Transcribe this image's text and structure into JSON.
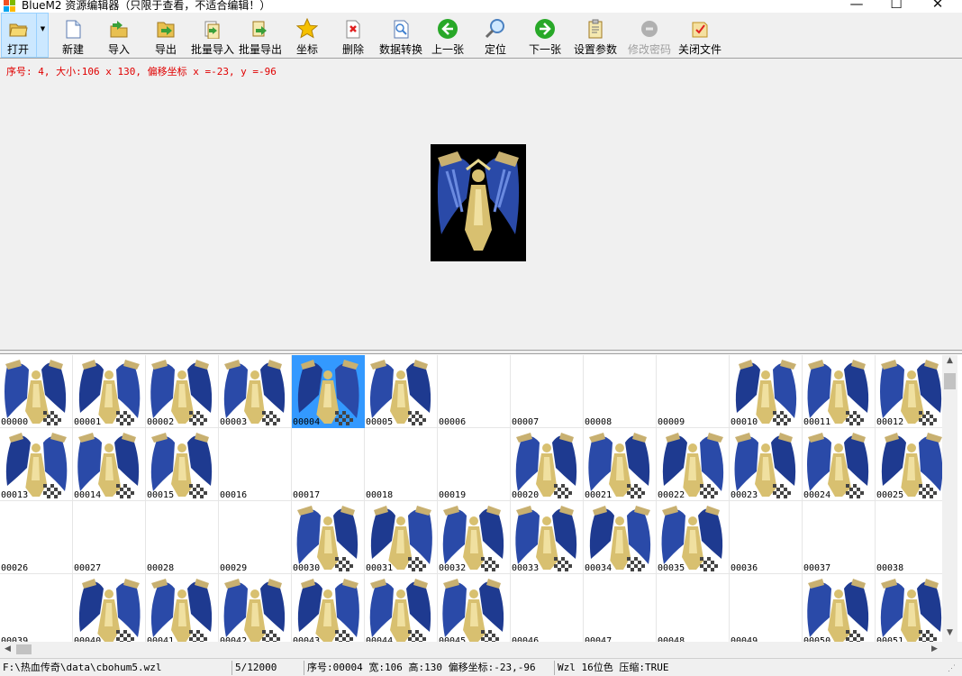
{
  "window": {
    "title": "BlueM2 资源编辑器（只限于查看，不适合编辑！）",
    "minimize_glyph": "—",
    "maximize_glyph": "☐",
    "close_glyph": "✕"
  },
  "toolbar": {
    "items": [
      {
        "label": "打开",
        "icon": "open-folder-icon",
        "enabled": true
      },
      {
        "label": "新建",
        "icon": "new-document-icon",
        "enabled": true
      },
      {
        "label": "导入",
        "icon": "import-icon",
        "enabled": true
      },
      {
        "label": "导出",
        "icon": "export-icon",
        "enabled": true
      },
      {
        "label": "批量导入",
        "icon": "batch-import-icon",
        "enabled": true
      },
      {
        "label": "批量导出",
        "icon": "batch-export-icon",
        "enabled": true
      },
      {
        "label": "坐标",
        "icon": "star-icon",
        "enabled": true
      },
      {
        "label": "删除",
        "icon": "delete-icon",
        "enabled": true
      },
      {
        "label": "数据转换",
        "icon": "convert-icon",
        "enabled": true
      },
      {
        "label": "上一张",
        "icon": "previous-icon",
        "enabled": true
      },
      {
        "label": "定位",
        "icon": "locate-icon",
        "enabled": true
      },
      {
        "label": "下一张",
        "icon": "next-icon",
        "enabled": true
      },
      {
        "label": "设置参数",
        "icon": "settings-clipboard-icon",
        "enabled": true
      },
      {
        "label": "修改密码",
        "icon": "password-icon",
        "enabled": false
      },
      {
        "label": "关闭文件",
        "icon": "close-file-icon",
        "enabled": true
      }
    ]
  },
  "preview": {
    "info": "序号: 4, 大小:106 x 130, 偏移坐标 x =-23, y =-96"
  },
  "grid": {
    "selected_index": 4,
    "cells": [
      {
        "label": "00000",
        "has_image": true
      },
      {
        "label": "00001",
        "has_image": true
      },
      {
        "label": "00002",
        "has_image": true
      },
      {
        "label": "00003",
        "has_image": true
      },
      {
        "label": "00004",
        "has_image": true
      },
      {
        "label": "00005",
        "has_image": true
      },
      {
        "label": "00006",
        "has_image": false
      },
      {
        "label": "00007",
        "has_image": false
      },
      {
        "label": "00008",
        "has_image": false
      },
      {
        "label": "00009",
        "has_image": false
      },
      {
        "label": "00010",
        "has_image": true
      },
      {
        "label": "00011",
        "has_image": true
      },
      {
        "label": "00012",
        "has_image": true
      },
      {
        "label": "00013",
        "has_image": true
      },
      {
        "label": "00014",
        "has_image": true
      },
      {
        "label": "00015",
        "has_image": true
      },
      {
        "label": "00016",
        "has_image": false
      },
      {
        "label": "00017",
        "has_image": false
      },
      {
        "label": "00018",
        "has_image": false
      },
      {
        "label": "00019",
        "has_image": false
      },
      {
        "label": "00020",
        "has_image": true
      },
      {
        "label": "00021",
        "has_image": true
      },
      {
        "label": "00022",
        "has_image": true
      },
      {
        "label": "00023",
        "has_image": true
      },
      {
        "label": "00024",
        "has_image": true
      },
      {
        "label": "00025",
        "has_image": true
      },
      {
        "label": "00026",
        "has_image": false
      },
      {
        "label": "00027",
        "has_image": false
      },
      {
        "label": "00028",
        "has_image": false
      },
      {
        "label": "00029",
        "has_image": false
      },
      {
        "label": "00030",
        "has_image": true
      },
      {
        "label": "00031",
        "has_image": true
      },
      {
        "label": "00032",
        "has_image": true
      },
      {
        "label": "00033",
        "has_image": true
      },
      {
        "label": "00034",
        "has_image": true
      },
      {
        "label": "00035",
        "has_image": true
      },
      {
        "label": "00036",
        "has_image": false
      },
      {
        "label": "00037",
        "has_image": false
      },
      {
        "label": "00038",
        "has_image": false
      },
      {
        "label": "00039",
        "has_image": false
      },
      {
        "label": "00040",
        "has_image": true
      },
      {
        "label": "00041",
        "has_image": true
      },
      {
        "label": "00042",
        "has_image": true
      },
      {
        "label": "00043",
        "has_image": true
      },
      {
        "label": "00044",
        "has_image": true
      },
      {
        "label": "00045",
        "has_image": true
      },
      {
        "label": "00046",
        "has_image": false
      },
      {
        "label": "00047",
        "has_image": false
      },
      {
        "label": "00048",
        "has_image": false
      },
      {
        "label": "00049",
        "has_image": false
      },
      {
        "label": "00050",
        "has_image": true
      },
      {
        "label": "00051",
        "has_image": true
      }
    ]
  },
  "statusbar": {
    "path": "F:\\热血传奇\\data\\cbohum5.wzl",
    "position": "5/12000",
    "detail": "序号:00004 宽:106 高:130 偏移坐标:-23,-96",
    "format": "Wzl 16位色 压缩:TRUE"
  },
  "colors": {
    "selection": "#3399ff",
    "info_text": "#e00000",
    "sprite_gold": "#d8c070",
    "sprite_blue": "#2a4aa8"
  }
}
